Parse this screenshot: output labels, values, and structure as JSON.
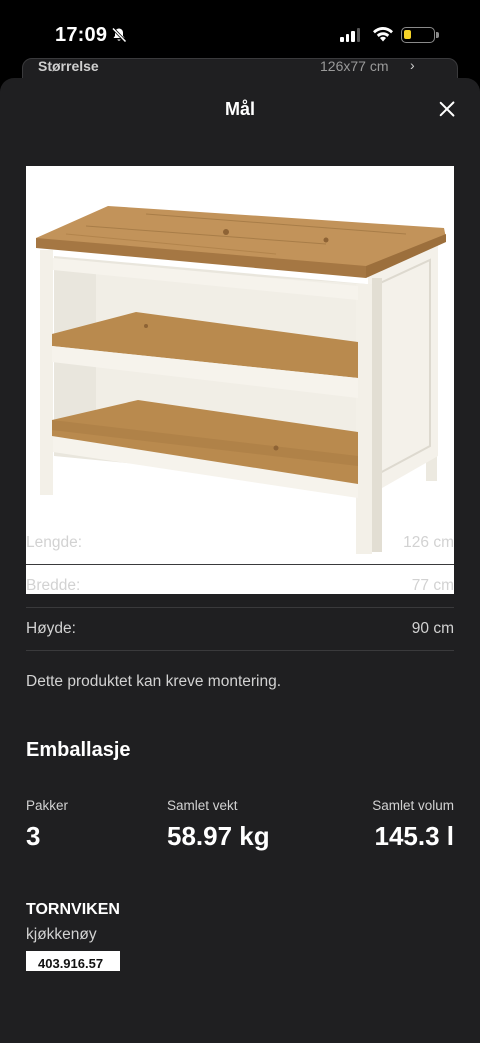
{
  "status_bar": {
    "time": "17:09"
  },
  "behind_card": {
    "label": "Størrelse",
    "value": "126x77 cm",
    "chevron": "›"
  },
  "sheet": {
    "title": "Mål",
    "close_icon": "close-icon"
  },
  "dimensions": [
    {
      "label": "Lengde:",
      "value": "126 cm"
    },
    {
      "label": "Bredde:",
      "value": "77 cm"
    },
    {
      "label": "Høyde:",
      "value": "90 cm"
    }
  ],
  "assembly_note": "Dette produktet kan kreve montering.",
  "packaging": {
    "heading": "Emballasje",
    "stats": [
      {
        "label": "Pakker",
        "value": "3"
      },
      {
        "label": "Samlet vekt",
        "value": "58.97 kg"
      },
      {
        "label": "Samlet volum",
        "value": "145.3 l"
      }
    ]
  },
  "product": {
    "name": "TORNVIKEN",
    "type": "kjøkkenøy",
    "article_number": "403.916.57"
  },
  "colors": {
    "sheet_bg": "#1f1f21",
    "divider": "#3a3a3c",
    "battery": "#f5d328",
    "wood": "#b98a4e",
    "frame": "#f2efe6"
  }
}
